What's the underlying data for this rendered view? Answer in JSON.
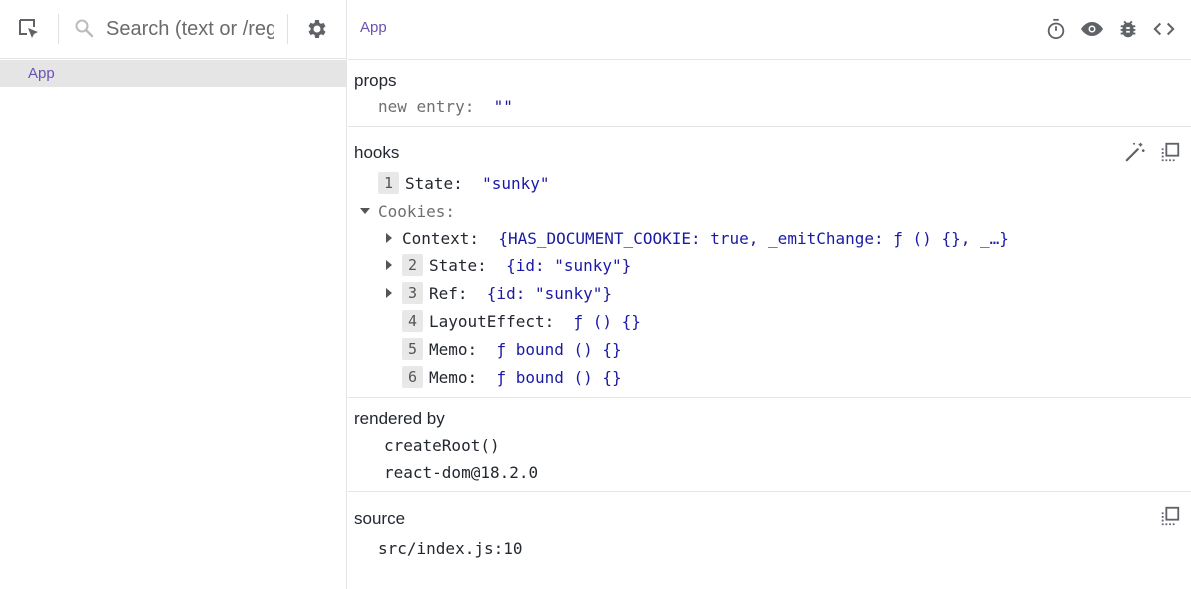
{
  "colors": {
    "accent": "#6a51b2",
    "value": "#1a1aa6",
    "divider": "#e5e5e5",
    "selected_bg": "#e5e5e5"
  },
  "left_toolbar": {
    "select_icon": "inspect-element-icon",
    "search_icon": "search-icon",
    "search_placeholder": "Search (text or /regex/)",
    "settings_icon": "gear-icon"
  },
  "tree": {
    "items": [
      {
        "label": "App",
        "selected": true
      }
    ]
  },
  "right_toolbar": {
    "selected_component": "App",
    "icons": [
      "stopwatch-icon",
      "eye-icon",
      "bug-icon",
      "code-icon"
    ]
  },
  "props": {
    "title": "props",
    "entries": [
      {
        "key": "new entry",
        "value": "\"\""
      }
    ]
  },
  "hooks": {
    "title": "hooks",
    "icons": [
      "magic-wand-icon",
      "copy-icon"
    ],
    "state_index": "1",
    "state_key": "State:",
    "state_value": "\"sunky\"",
    "cookies_key": "Cookies:",
    "context_key": "Context:",
    "context_value": "{HAS_DOCUMENT_COOKIE: true, _emitChange: ƒ () {}, _…}",
    "items": [
      {
        "index": "2",
        "key": "State:",
        "value": "{id: \"sunky\"}"
      },
      {
        "index": "3",
        "key": "Ref:",
        "value": "{id: \"sunky\"}"
      },
      {
        "index": "4",
        "key": "LayoutEffect:",
        "value": "ƒ () {}"
      },
      {
        "index": "5",
        "key": "Memo:",
        "value": "ƒ bound () {}"
      },
      {
        "index": "6",
        "key": "Memo:",
        "value": "ƒ bound () {}"
      }
    ]
  },
  "rendered_by": {
    "title": "rendered by",
    "items": [
      "createRoot()",
      "react-dom@18.2.0"
    ]
  },
  "source": {
    "title": "source",
    "icon": "copy-icon",
    "location": "src/index.js:10"
  }
}
